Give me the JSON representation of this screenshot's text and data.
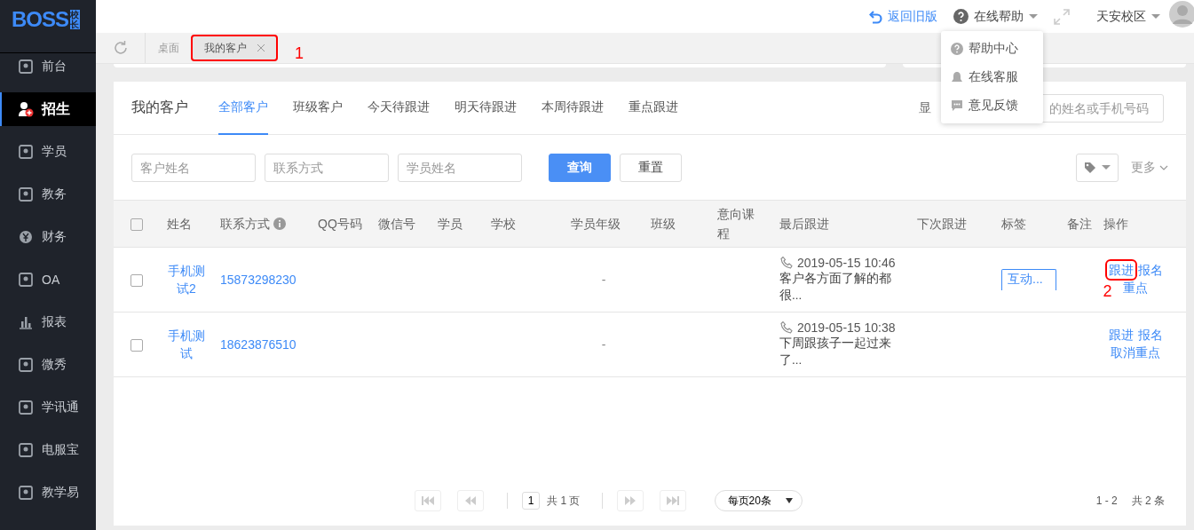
{
  "logo": {
    "text": "BOSS",
    "badge": "校长"
  },
  "header": {
    "back_link": "返回旧版",
    "help_menu": "在线帮助",
    "campus": "天安校区"
  },
  "help_dropdown": {
    "items": [
      "帮助中心",
      "在线客服",
      "意见反馈"
    ]
  },
  "sidebar": {
    "items": [
      {
        "label": "前台",
        "selected": false
      },
      {
        "label": "招生",
        "selected": true
      },
      {
        "label": "学员",
        "selected": false
      },
      {
        "label": "教务",
        "selected": false
      },
      {
        "label": "财务",
        "selected": false
      },
      {
        "label": "OA",
        "selected": false
      },
      {
        "label": "报表",
        "selected": false
      },
      {
        "label": "微秀",
        "selected": false
      },
      {
        "label": "学讯通",
        "selected": false
      },
      {
        "label": "电服宝",
        "selected": false
      },
      {
        "label": "教学易",
        "selected": false
      }
    ]
  },
  "page_tabs": [
    {
      "label": "桌面",
      "selected": false,
      "closable": false,
      "highlighted": false
    },
    {
      "label": "我的客户",
      "selected": true,
      "closable": true,
      "highlighted": true,
      "annotation": "1"
    }
  ],
  "card": {
    "title": "我的客户",
    "tabs": [
      {
        "label": "全部客户",
        "selected": true
      },
      {
        "label": "班级客户",
        "selected": false
      },
      {
        "label": "今天待跟进",
        "selected": false
      },
      {
        "label": "明天待跟进",
        "selected": false
      },
      {
        "label": "本周待跟进",
        "selected": false
      },
      {
        "label": "重点跟进",
        "selected": false
      }
    ],
    "search_label": "显",
    "search_placeholder": "的姓名或手机号码"
  },
  "filters": [
    {
      "placeholder": "客户姓名"
    },
    {
      "placeholder": "联系方式"
    },
    {
      "placeholder": "学员姓名"
    }
  ],
  "buttons": {
    "query": "查询",
    "reset": "重置",
    "more": "更多"
  },
  "table": {
    "header_checked": false,
    "columns": [
      {
        "label": "姓名",
        "info": false
      },
      {
        "label": "联系方式",
        "info": true
      },
      {
        "label": "QQ号码",
        "info": false
      },
      {
        "label": "微信号",
        "info": false
      },
      {
        "label": "学员",
        "info": false
      },
      {
        "label": "学校",
        "info": false
      },
      {
        "label": "学员年级",
        "info": false
      },
      {
        "label": "班级",
        "info": false
      },
      {
        "label": "意向课程",
        "info": false
      },
      {
        "label": "最后跟进",
        "info": false
      },
      {
        "label": "下次跟进",
        "info": false
      },
      {
        "label": "标签",
        "info": false
      },
      {
        "label": "备注",
        "info": false
      },
      {
        "label": "操作",
        "info": false
      }
    ],
    "rows": [
      {
        "checked": false,
        "name": "手机测试2",
        "phone": "15873298230",
        "student_grade": "-",
        "last_follow_time": "2019-05-15 10:46",
        "last_follow_note": "客户各方面了解的都很...",
        "tag": "互动...",
        "actions": [
          {
            "label": "跟进",
            "highlighted": true,
            "annotation": "2"
          },
          {
            "label": "报名",
            "highlighted": false
          },
          {
            "label": "重点",
            "highlighted": false
          }
        ]
      },
      {
        "checked": false,
        "name": "手机测试",
        "phone": "18623876510",
        "student_grade": "-",
        "last_follow_time": "2019-05-15 10:38",
        "last_follow_note": "下周跟孩子一起过来了...",
        "actions": [
          {
            "label": "跟进",
            "highlighted": false
          },
          {
            "label": "报名",
            "highlighted": false
          },
          {
            "label": "取消重点",
            "highlighted": false
          }
        ]
      }
    ]
  },
  "pagination": {
    "page": "1",
    "total_pages": "共 1 页",
    "page_size": "每页20条",
    "range": "1 - 2",
    "total": "共 2 条"
  }
}
